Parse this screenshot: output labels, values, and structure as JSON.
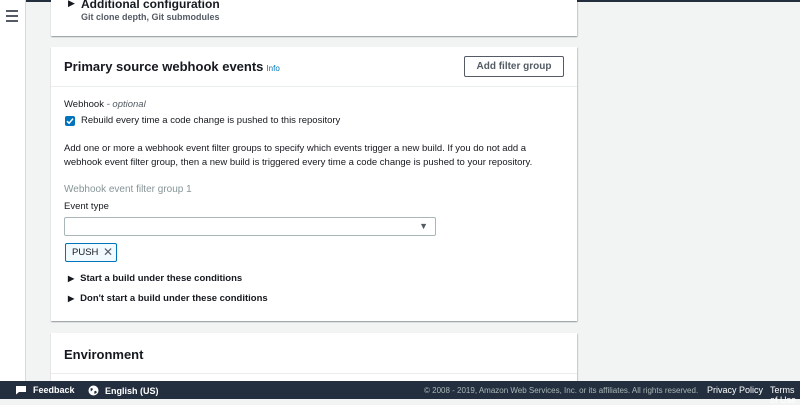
{
  "nav": {
    "menu_icon": "hamburger-menu-icon"
  },
  "additional_configuration": {
    "title": "Additional configuration",
    "subtitle": "Git clone depth, Git submodules"
  },
  "webhook_section": {
    "title": "Primary source webhook events",
    "info_link": "Info",
    "add_filter_group_label": "Add filter group",
    "webhook_label": "Webhook",
    "webhook_optional": "- optional",
    "rebuild_checkbox_label": "Rebuild every time a code change is pushed to this repository",
    "rebuild_checked": true,
    "description": "Add one or more a webhook event filter groups to specify which events trigger a new build. If you do not add a webhook event filter group, then a new build is triggered every time a code change is pushed to your repository.",
    "filter_group_title": "Webhook event filter group 1",
    "event_type_label": "Event type",
    "event_type_value": "",
    "selected_tokens": [
      "PUSH"
    ],
    "expanders": [
      "Start a build under these conditions",
      "Don't start a build under these conditions"
    ]
  },
  "environment_section": {
    "title": "Environment"
  },
  "footer": {
    "feedback_label": "Feedback",
    "language_label": "English (US)",
    "copyright": "© 2008 - 2019, Amazon Web Services, Inc. or its affiliates. All rights reserved.",
    "privacy_label": "Privacy Policy",
    "terms_label": "Terms of Use"
  },
  "colors": {
    "accent": "#0073bb",
    "footer_bg": "#232f3e",
    "page_bg": "#f2f3f3"
  }
}
